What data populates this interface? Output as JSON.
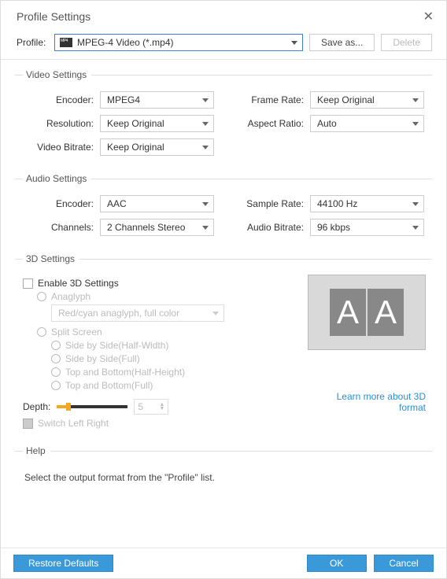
{
  "header": {
    "title": "Profile Settings"
  },
  "profile": {
    "label": "Profile:",
    "value": "MPEG-4 Video (*.mp4)",
    "save_as": "Save as...",
    "delete": "Delete"
  },
  "video": {
    "legend": "Video Settings",
    "encoder_label": "Encoder:",
    "encoder": "MPEG4",
    "framerate_label": "Frame Rate:",
    "framerate": "Keep Original",
    "resolution_label": "Resolution:",
    "resolution": "Keep Original",
    "aspect_label": "Aspect Ratio:",
    "aspect": "Auto",
    "bitrate_label": "Video Bitrate:",
    "bitrate": "Keep Original"
  },
  "audio": {
    "legend": "Audio Settings",
    "encoder_label": "Encoder:",
    "encoder": "AAC",
    "samplerate_label": "Sample Rate:",
    "samplerate": "44100 Hz",
    "channels_label": "Channels:",
    "channels": "2 Channels Stereo",
    "bitrate_label": "Audio Bitrate:",
    "bitrate": "96 kbps"
  },
  "threeD": {
    "legend": "3D Settings",
    "enable": "Enable 3D Settings",
    "anaglyph": "Anaglyph",
    "anaglyph_sel": "Red/cyan anaglyph, full color",
    "split": "Split Screen",
    "sbs_half": "Side by Side(Half-Width)",
    "sbs_full": "Side by Side(Full)",
    "tb_half": "Top and Bottom(Half-Height)",
    "tb_full": "Top and Bottom(Full)",
    "depth_label": "Depth:",
    "depth_value": "5",
    "switch_lr": "Switch Left Right",
    "learn_link": "Learn more about 3D format",
    "preview_letter": "A"
  },
  "help": {
    "legend": "Help",
    "text": "Select the output format from the \"Profile\" list."
  },
  "footer": {
    "restore": "Restore Defaults",
    "ok": "OK",
    "cancel": "Cancel"
  }
}
